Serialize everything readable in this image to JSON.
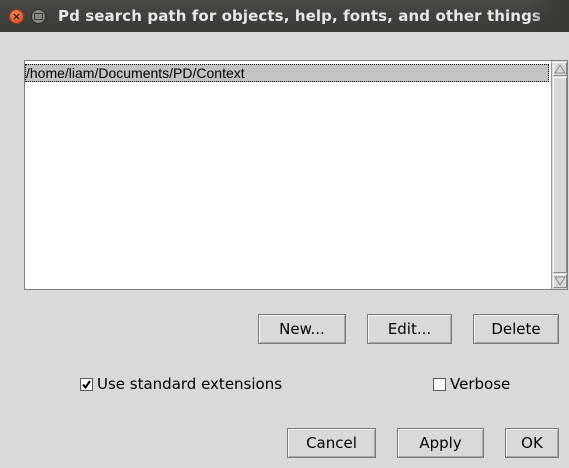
{
  "window": {
    "title": "Pd search path for objects, help, fonts, and other things"
  },
  "path_list": {
    "items": [
      "/home/liam/Documents/PD/Context"
    ],
    "selected_index": 0
  },
  "list_buttons": {
    "new_label": "New...",
    "edit_label": "Edit...",
    "delete_label": "Delete"
  },
  "options": {
    "use_standard_extensions": {
      "label": "Use standard extensions",
      "checked": true
    },
    "verbose": {
      "label": "Verbose",
      "checked": false
    }
  },
  "dialog_buttons": {
    "cancel_label": "Cancel",
    "apply_label": "Apply",
    "ok_label": "OK"
  },
  "colors": {
    "titlebar": "#3c3b37",
    "close_button": "#e95420",
    "dialog_bg": "#d9d9d9",
    "selection": "#c3c3c3"
  }
}
